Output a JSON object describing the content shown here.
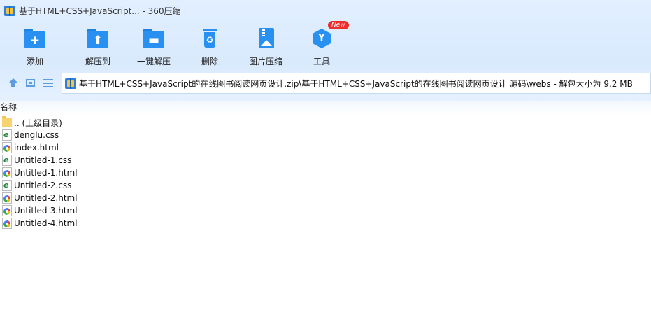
{
  "window": {
    "title": "基于HTML+CSS+JavaScript... - 360压缩"
  },
  "toolbar": [
    {
      "label": "添加",
      "icon": "add-icon"
    },
    {
      "label": "解压到",
      "icon": "extract-to-icon"
    },
    {
      "label": "一键解压",
      "icon": "one-click-extract-icon"
    },
    {
      "label": "删除",
      "icon": "delete-icon"
    },
    {
      "label": "图片压缩",
      "icon": "image-compress-icon"
    },
    {
      "label": "工具",
      "icon": "tools-icon",
      "badge": "New"
    }
  ],
  "address": {
    "path": "基于HTML+CSS+JavaScript的在线图书阅读网页设计.zip\\基于HTML+CSS+JavaScript的在线图书阅读网页设计 源码\\webs - 解包大小为 9.2 MB"
  },
  "list": {
    "column_header": "名称",
    "files": [
      {
        "name": ".. (上级目录)",
        "type": "folder"
      },
      {
        "name": "denglu.css",
        "type": "css"
      },
      {
        "name": "index.html",
        "type": "html"
      },
      {
        "name": "Untitled-1.css",
        "type": "css"
      },
      {
        "name": "Untitled-1.html",
        "type": "html"
      },
      {
        "name": "Untitled-2.css",
        "type": "css"
      },
      {
        "name": "Untitled-2.html",
        "type": "html"
      },
      {
        "name": "Untitled-3.html",
        "type": "html"
      },
      {
        "name": "Untitled-4.html",
        "type": "html"
      }
    ]
  },
  "colors": {
    "accent": "#2890f0",
    "header_bg": "#dcebfd",
    "badge": "#ee2c2c"
  }
}
